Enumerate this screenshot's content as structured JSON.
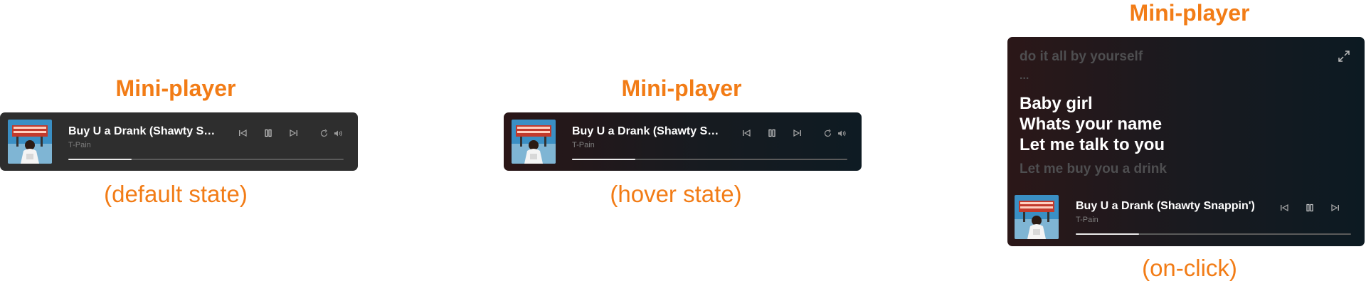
{
  "panels": [
    {
      "heading": "Mini-player",
      "caption": "(default state)"
    },
    {
      "heading": "Mini-player",
      "caption": "(hover state)"
    },
    {
      "heading": "Mini-player",
      "caption": "(on-click)"
    }
  ],
  "player": {
    "title_truncated": "Buy U a Drank (Shawty Sna...",
    "title_full": "Buy U a Drank (Shawty Snappin')",
    "artist": "T-Pain",
    "progress_fraction": 0.23
  },
  "lyrics": {
    "previous": [
      "do it all by yourself",
      "..."
    ],
    "current": [
      "Baby girl",
      "Whats your name",
      "Let me talk to you"
    ],
    "next": [
      "Let me buy you a drink"
    ]
  },
  "icons": {
    "previous": "skip-previous-icon",
    "pause": "pause-icon",
    "next": "skip-next-icon",
    "repeat": "repeat-icon",
    "volume": "volume-icon",
    "expand": "expand-icon"
  },
  "colors": {
    "accent": "#f27c16",
    "player_default_bg": "#2e2e2e",
    "player_hover_bg_start": "#2a1617",
    "player_hover_bg_end": "#0e1b23",
    "progress_fill": "#e9e9e9",
    "progress_track": "#5a5a5a",
    "lyric_dim": "#4e4e50"
  }
}
